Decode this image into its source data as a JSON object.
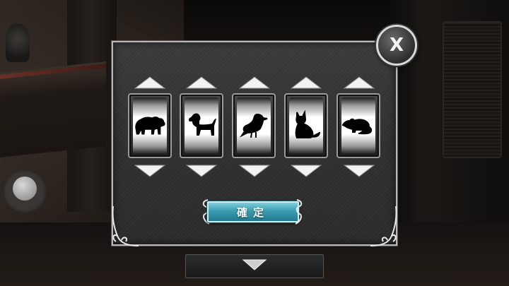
{
  "dialog": {
    "close_label": "X",
    "confirm_label": "確定",
    "reels": [
      {
        "symbol": "bear-icon"
      },
      {
        "symbol": "dog-icon"
      },
      {
        "symbol": "bird-icon"
      },
      {
        "symbol": "cat-icon"
      },
      {
        "symbol": "rat-icon"
      }
    ]
  },
  "controls": {
    "joystick": "virtual-joystick",
    "bottom_tab_icon": "chevron-down-icon"
  },
  "colors": {
    "panel": "#2f2f2f",
    "border": "#b9b9b9",
    "confirm_button": "#3a9db1",
    "reel_face": "#ffffff",
    "silhouette": "#000000"
  }
}
